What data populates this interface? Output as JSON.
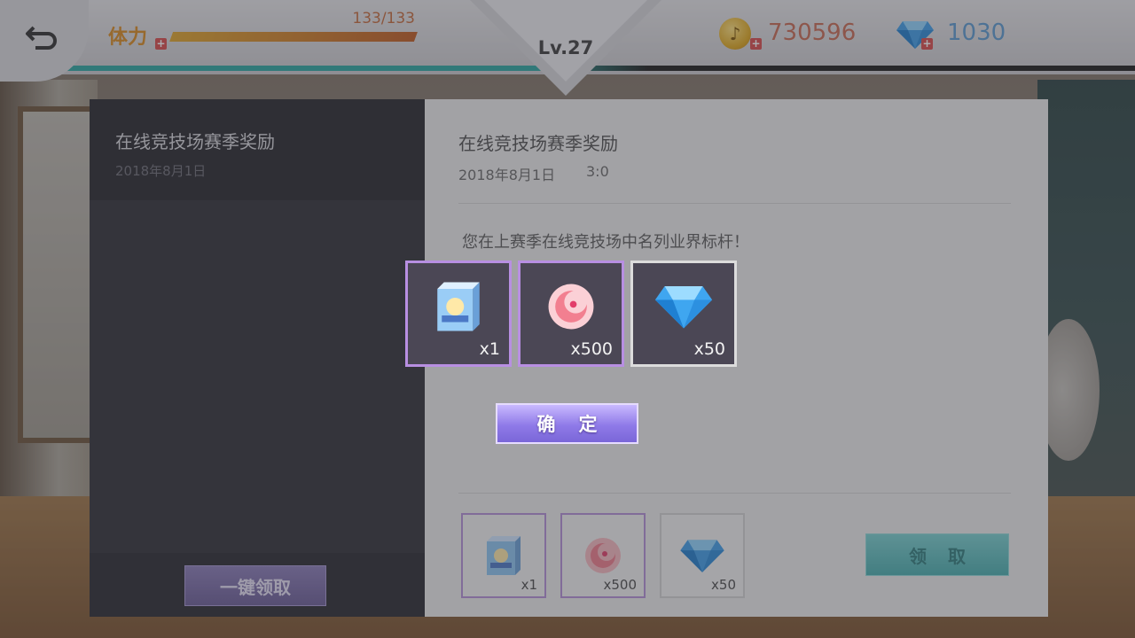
{
  "topbar": {
    "stamina_label": "体力",
    "stamina_value": "133/133",
    "stamina_current": 133,
    "stamina_max": 133,
    "level": "Lv.27",
    "coins": "730596",
    "gems": "1030"
  },
  "mail_list": {
    "items": [
      {
        "title": "在线竞技场赛季奖励",
        "date": "2018年8月1日"
      }
    ],
    "claim_all_label": "一键领取"
  },
  "detail": {
    "title": "在线竞技场赛季奖励",
    "date": "2018年8月1日",
    "time": "3:0",
    "message": "您在上赛季在线竞技场中名列业界标杆！",
    "attachments": [
      {
        "icon": "badge-box-icon",
        "qty": "x1"
      },
      {
        "icon": "pink-token-icon",
        "qty": "x500"
      },
      {
        "icon": "diamond-icon",
        "qty": "x50"
      }
    ],
    "receive_label": "领取"
  },
  "modal": {
    "rewards": [
      {
        "icon": "badge-box-icon",
        "qty": "x1"
      },
      {
        "icon": "pink-token-icon",
        "qty": "x500"
      },
      {
        "icon": "diamond-icon",
        "qty": "x50"
      }
    ],
    "confirm_label": "确定"
  },
  "colors": {
    "accent_teal": "#2aa6a0",
    "confirm_purple": "#8f7ae8",
    "receive_teal": "#48aeae",
    "rarity_purple": "#b88fe2"
  }
}
